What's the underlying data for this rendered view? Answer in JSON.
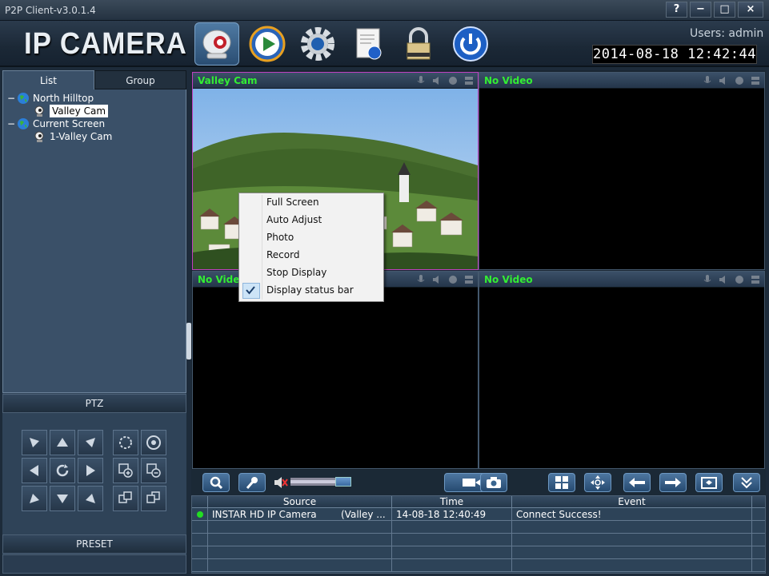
{
  "window": {
    "title": "P2P Client-v3.0.1.4",
    "help_btn": "?",
    "min_btn": "−",
    "max_btn": "□",
    "close_btn": "×"
  },
  "header": {
    "logo": "IP CAMERA",
    "users_label": "Users: admin",
    "datetime": "2014-08-18  12:42:44",
    "nav_icons": [
      "camera-live-icon",
      "playback-icon",
      "settings-gear-icon",
      "log-document-icon",
      "lock-icon",
      "power-icon"
    ]
  },
  "left": {
    "tabs": [
      "List",
      "Group"
    ],
    "tree": [
      {
        "toggle": "−",
        "label": "North Hilltop",
        "icon": "globe-icon",
        "level": 0
      },
      {
        "label": "Valley Cam",
        "icon": "camera-icon",
        "level": 1,
        "selected": true
      },
      {
        "toggle": "−",
        "label": "Current Screen",
        "icon": "globe-icon",
        "level": 0
      },
      {
        "label": "1-Valley Cam",
        "icon": "camera-icon",
        "level": 1
      }
    ],
    "ptz_label": "PTZ",
    "preset_label": "PRESET"
  },
  "video": {
    "cells": [
      {
        "name": "Valley Cam",
        "selected": true
      },
      {
        "name": "No Video"
      },
      {
        "name": "No Video"
      },
      {
        "name": "No Video"
      }
    ]
  },
  "context_menu": {
    "items": [
      {
        "label": "Full Screen",
        "checked": false
      },
      {
        "label": "Auto Adjust",
        "checked": false
      },
      {
        "label": "Photo",
        "checked": false
      },
      {
        "label": "Record",
        "checked": false
      },
      {
        "label": "Stop Display",
        "checked": false
      },
      {
        "label": "Display status bar",
        "checked": true
      }
    ]
  },
  "events": {
    "columns": [
      "Source",
      "Time",
      "Event"
    ],
    "rows": [
      {
        "source": "INSTAR HD IP Camera",
        "source_extra": "(Valley ...",
        "time": "14-08-18 12:40:49",
        "event": "Connect Success!",
        "status_color": "#22dd22"
      }
    ]
  },
  "colors": {
    "accent": "#33ee33",
    "selection": "#c040c0",
    "panel": "#3a5068"
  }
}
